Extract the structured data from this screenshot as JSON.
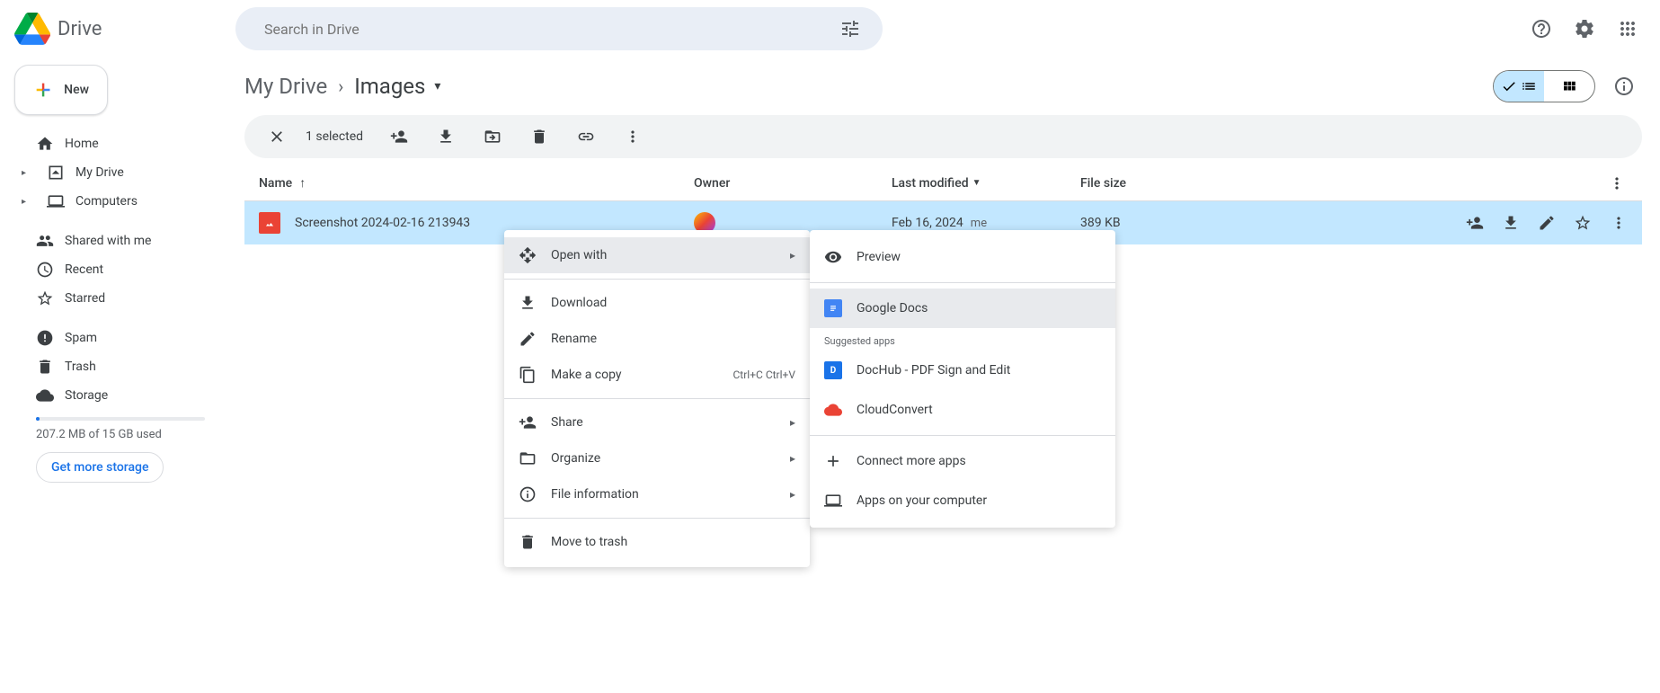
{
  "app_title": "Drive",
  "search_placeholder": "Search in Drive",
  "new_button": "New",
  "sidebar": {
    "home": "Home",
    "my_drive": "My Drive",
    "computers": "Computers",
    "shared": "Shared with me",
    "recent": "Recent",
    "starred": "Starred",
    "spam": "Spam",
    "trash": "Trash",
    "storage": "Storage",
    "storage_used": "207.2 MB of 15 GB used",
    "get_more": "Get more storage"
  },
  "breadcrumb": {
    "root": "My Drive",
    "current": "Images"
  },
  "selection": {
    "count": "1 selected"
  },
  "columns": {
    "name": "Name",
    "owner": "Owner",
    "modified": "Last modified",
    "size": "File size"
  },
  "file": {
    "name": "Screenshot 2024-02-16 213943",
    "modified": "Feb 16, 2024",
    "modified_by": "me",
    "size": "389 KB"
  },
  "context_menu": {
    "open_with": "Open with",
    "download": "Download",
    "rename": "Rename",
    "make_copy": "Make a copy",
    "make_copy_shortcut": "Ctrl+C Ctrl+V",
    "share": "Share",
    "organize": "Organize",
    "file_info": "File information",
    "trash": "Move to trash"
  },
  "submenu": {
    "preview": "Preview",
    "google_docs": "Google Docs",
    "suggested": "Suggested apps",
    "dochub": "DocHub - PDF Sign and Edit",
    "cloudconvert": "CloudConvert",
    "connect_more": "Connect more apps",
    "apps_computer": "Apps on your computer"
  }
}
